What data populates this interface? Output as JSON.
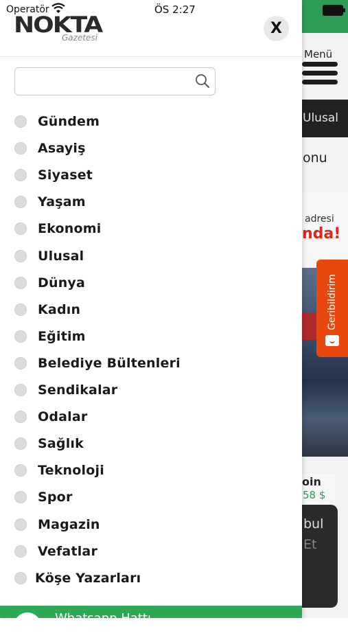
{
  "status_bar": {
    "operator": "Operatör",
    "time": "ÖS 2:27"
  },
  "logo": {
    "name": "NOKTA",
    "subtitle": "Gazetesi"
  },
  "close_label": "X",
  "search": {
    "placeholder": "",
    "value": ""
  },
  "categories": [
    "Gündem",
    "Asayiş",
    "Siyaset",
    "Yaşam",
    "Ekonomi",
    "Ulusal",
    "Dünya",
    "Kadın",
    "Eğitim",
    "Belediye Bültenleri",
    "Sendikalar",
    "Odalar",
    "Sağlık",
    "Teknoloji",
    "Spor",
    "Magazin",
    "Vefatlar",
    "Köşe Yazarları"
  ],
  "bottom_bar": {
    "label": "Whatsapp Hattı"
  },
  "background_page": {
    "menu_label": "Menü",
    "tab_partial": "Ulusal",
    "heading_partial": "onu",
    "ad_text_1": "adresi",
    "ad_text_2": "nda!",
    "feedback_label": "Geribildirim",
    "coin_label": "oin",
    "coin_price": "58 $",
    "card_text_1": "bul",
    "card_text_2": "Et"
  },
  "colors": {
    "brand_green": "#2f9d57",
    "feedback_orange": "#e8470e",
    "ad_red": "#e0251b"
  }
}
